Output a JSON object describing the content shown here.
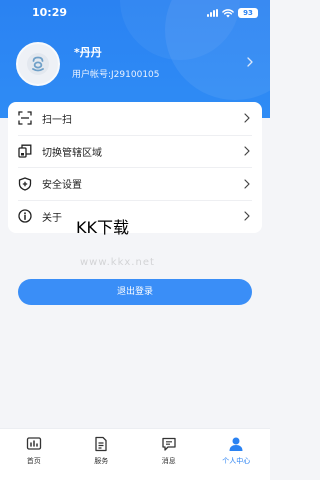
{
  "status_bar": {
    "time": "10:29",
    "battery": "93"
  },
  "profile": {
    "name": "*丹丹",
    "account": "用户帐号:J29100105"
  },
  "menu": {
    "items": [
      {
        "label": "扫一扫",
        "icon": "scan-icon"
      },
      {
        "label": "切换管辖区域",
        "icon": "switch-region-icon"
      },
      {
        "label": "安全设置",
        "icon": "shield-plus-icon"
      },
      {
        "label": "关于",
        "icon": "info-icon"
      }
    ]
  },
  "watermark": {
    "logo": "KK下载",
    "url": "www.kkx.net"
  },
  "logout_label": "退出登录",
  "tabs": [
    {
      "label": "首页",
      "icon": "home-chart-icon",
      "active": false
    },
    {
      "label": "服务",
      "icon": "document-icon",
      "active": false
    },
    {
      "label": "消息",
      "icon": "message-icon",
      "active": false
    },
    {
      "label": "个人中心",
      "icon": "person-icon",
      "active": true
    }
  ],
  "colors": {
    "primary": "#2a82f2",
    "header_bg": "#2f8cf5",
    "button_bg": "#3a8ef7",
    "page_bg": "#f4f5f8",
    "text": "#222222"
  }
}
